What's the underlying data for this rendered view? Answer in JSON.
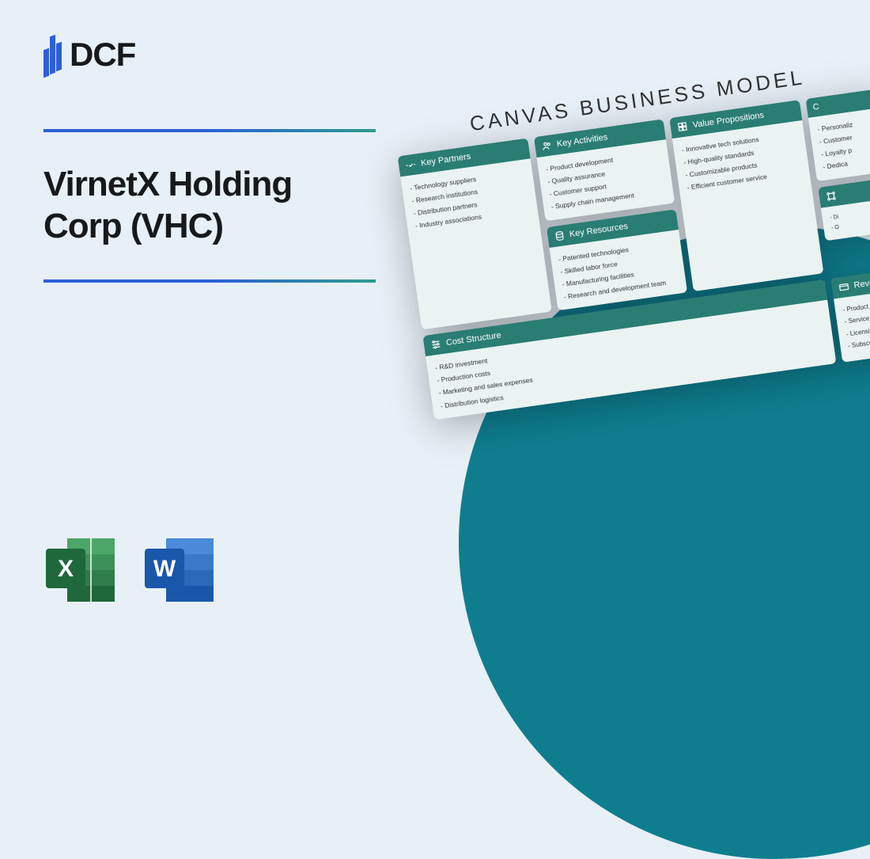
{
  "brand": "DCF",
  "title_line1": "VirnetX Holding",
  "title_line2": "Corp (VHC)",
  "board_title": "CANVAS BUSINESS MODEL",
  "canvas": {
    "key_partners": {
      "label": "Key Partners",
      "items": [
        "- Technology suppliers",
        "- Research institutions",
        "- Distribution partners",
        "- Industry associations"
      ]
    },
    "key_activities": {
      "label": "Key Activities",
      "items": [
        "- Product development",
        "- Quality assurance",
        "- Customer support",
        "- Supply chain management"
      ]
    },
    "key_resources": {
      "label": "Key Resources",
      "items": [
        "- Patented technologies",
        "- Skilled labor force",
        "- Manufacturing facilities",
        "- Research and development team"
      ]
    },
    "value_propositions": {
      "label": "Value Propositions",
      "items": [
        "- Innovative tech solutions",
        "- High-quality standards",
        "- Customizable products",
        "- Efficient customer service"
      ]
    },
    "customer_relationships": {
      "label": "C",
      "items": [
        "- Personaliz",
        "- Customer",
        "- Loyalty p",
        "- Dedica"
      ]
    },
    "cost_structure": {
      "label": "Cost Structure",
      "items": [
        "- R&D investment",
        "- Production costs",
        "- Marketing and sales expenses",
        "- Distribution logistics"
      ]
    },
    "revenue_streams": {
      "label": "Revenue S",
      "items": [
        "- Product sales",
        "- Service contracts",
        "- Licensing agreem",
        "- Subscription mo"
      ]
    }
  }
}
